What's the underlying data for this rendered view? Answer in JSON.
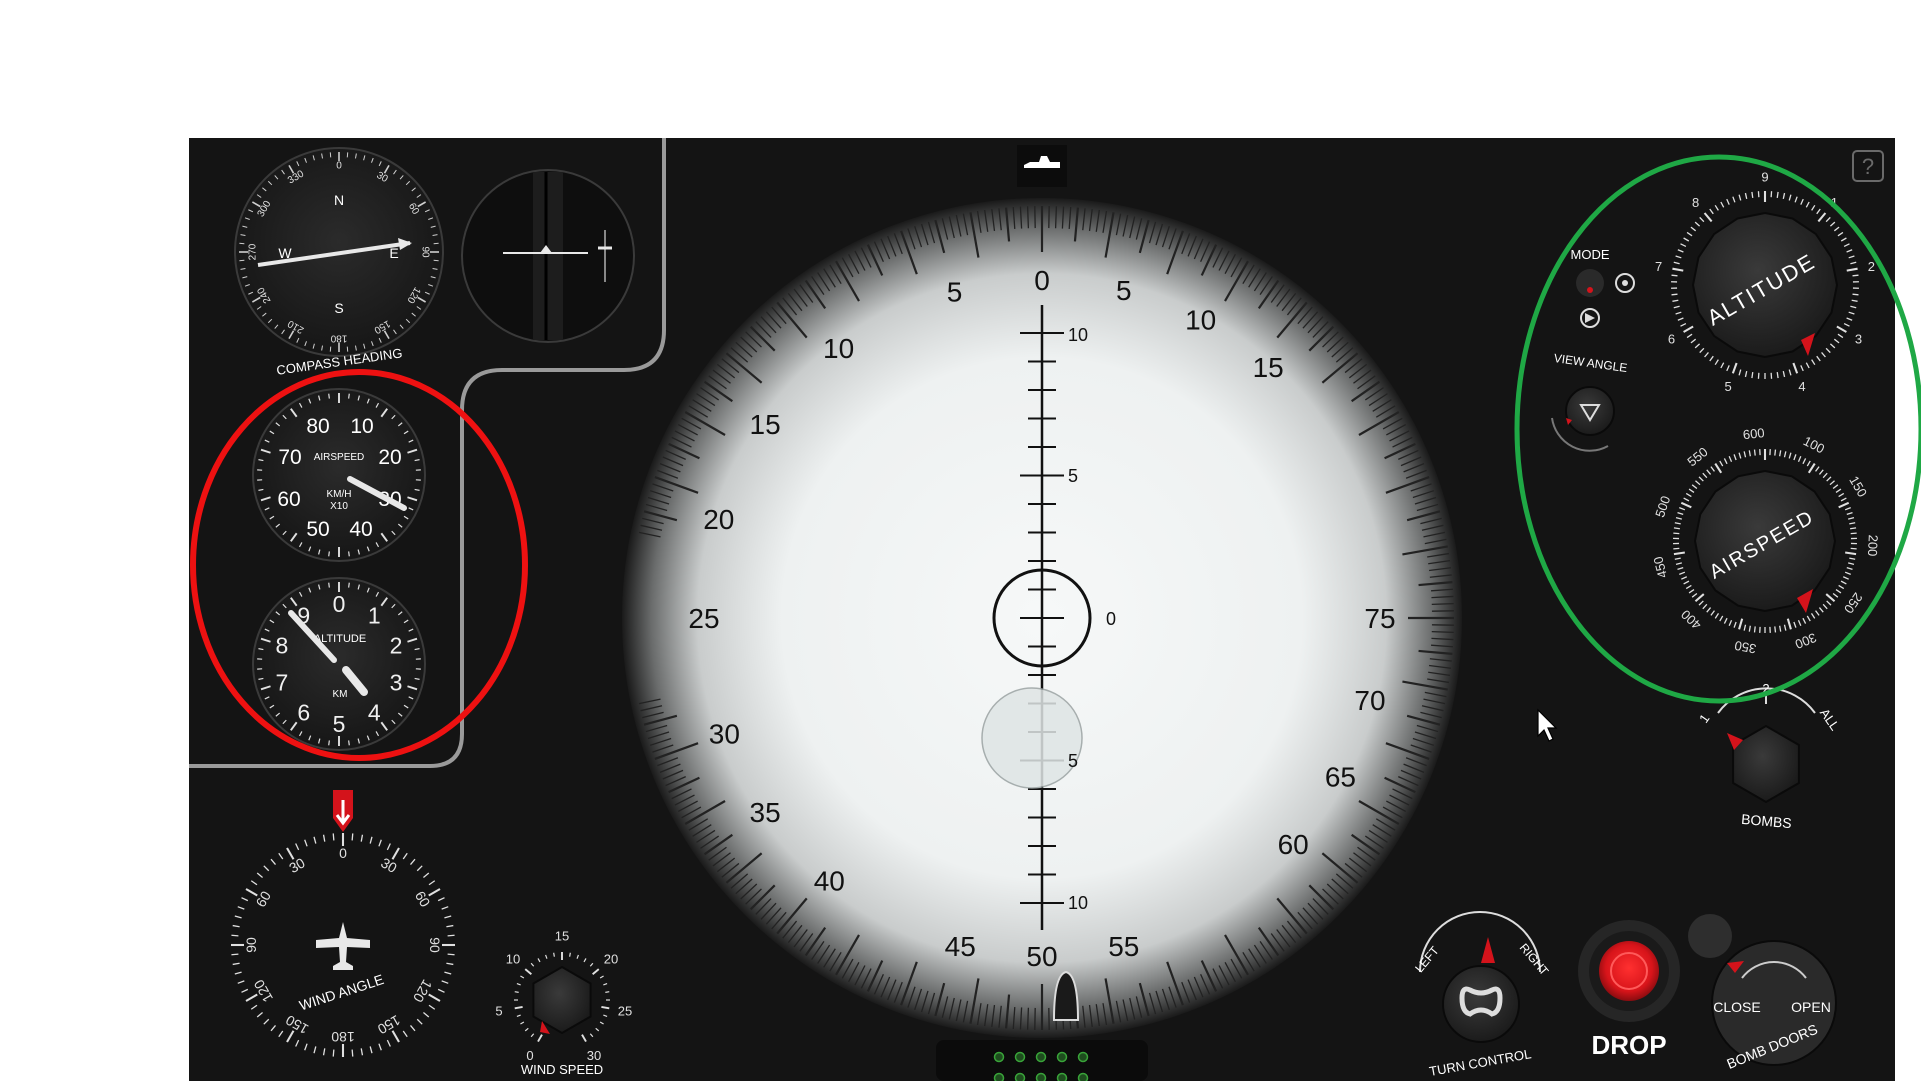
{
  "help_icon": "question-icon",
  "top_icon": "aircraft-silhouette-icon",
  "compass": {
    "label": "COMPASS HEADING",
    "cardinals": [
      "N",
      "E",
      "S",
      "W"
    ],
    "ticks": [
      "0",
      "30",
      "60",
      "90",
      "120",
      "150",
      "180",
      "210",
      "240",
      "270",
      "300",
      "330"
    ]
  },
  "attitude_indicator": {
    "icon": "artificial-horizon-icon"
  },
  "airspeed_gauge": {
    "label": "AIRSPEED",
    "unit": "KM/H",
    "multiplier": "X10",
    "numbers": [
      "10",
      "20",
      "30",
      "40",
      "50",
      "60",
      "70",
      "80"
    ]
  },
  "altitude_gauge": {
    "label": "ALTITUDE",
    "unit": "KM",
    "numbers": [
      "0",
      "1",
      "2",
      "3",
      "4",
      "5",
      "6",
      "7",
      "8",
      "9"
    ]
  },
  "wind_angle": {
    "label": "WIND ANGLE",
    "numbers": [
      "0",
      "30",
      "60",
      "90",
      "120",
      "150",
      "180",
      "150",
      "120",
      "90",
      "60",
      "30"
    ]
  },
  "wind_speed": {
    "label": "WIND SPEED",
    "numbers": [
      "0",
      "5",
      "10",
      "15",
      "20",
      "25",
      "30"
    ]
  },
  "sight": {
    "ring_numbers": [
      "0",
      "5",
      "10",
      "15",
      "20",
      "25",
      "30",
      "35",
      "40",
      "45",
      "50",
      "55",
      "60",
      "65",
      "70",
      "75",
      "15",
      "10",
      "5"
    ],
    "reticle_numbers": [
      "10",
      "5",
      "0",
      "5",
      "10"
    ]
  },
  "mode_control": {
    "label": "MODE"
  },
  "view_angle_control": {
    "label": "VIEW ANGLE"
  },
  "altitude_knob": {
    "label": "ALTITUDE",
    "numbers": [
      "9",
      "1",
      "2",
      "3",
      "4",
      "5",
      "6",
      "7",
      "8"
    ]
  },
  "airspeed_knob": {
    "label": "AIRSPEED",
    "numbers": [
      "100",
      "150",
      "200",
      "250",
      "300",
      "350",
      "400",
      "450",
      "500",
      "550",
      "600"
    ]
  },
  "bombs_selector": {
    "label": "BOMBS",
    "left": "1",
    "top": "2",
    "right": "ALL"
  },
  "turn_control": {
    "label": "TURN CONTROL",
    "left": "LEFT",
    "right": "RIGHT"
  },
  "drop_button": {
    "label": "DROP"
  },
  "bomb_doors": {
    "label": "BOMB DOORS",
    "close": "CLOSE",
    "open": "OPEN"
  },
  "colors": {
    "panel": "#141414",
    "accent_red": "#d4131b",
    "highlight_red": "#ee1111",
    "highlight_green": "#1fa845",
    "sight_white": "#f4f6f6"
  }
}
